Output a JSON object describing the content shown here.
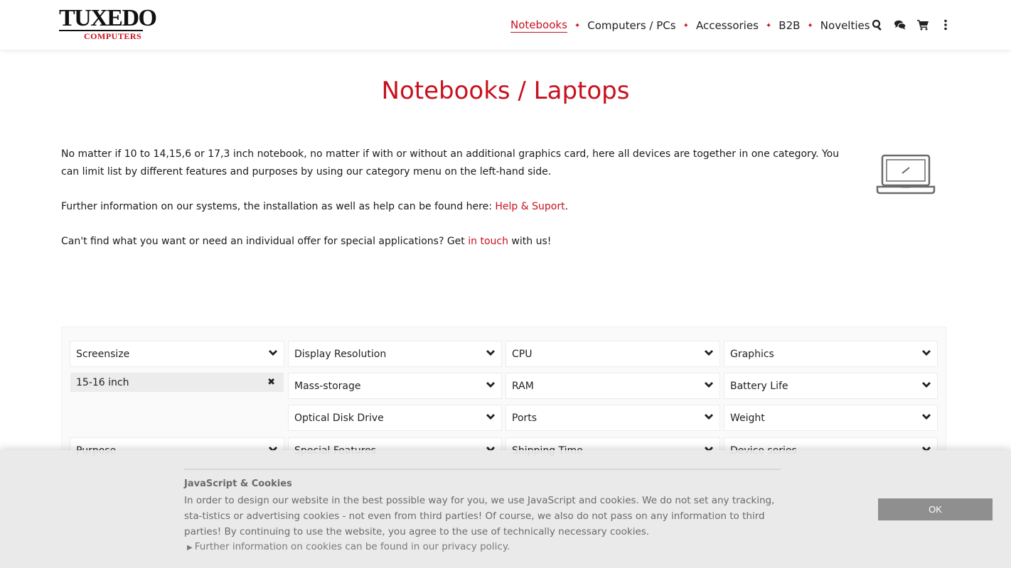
{
  "brand": {
    "name": "TUXEDO",
    "sub": "COMPUTERS"
  },
  "nav": {
    "items": [
      {
        "label": "Notebooks",
        "active": true
      },
      {
        "label": "Computers / PCs"
      },
      {
        "label": "Accessories"
      },
      {
        "label": "B2B"
      },
      {
        "label": "Novelties"
      }
    ],
    "icons": [
      "search-icon",
      "comments-icon",
      "cart-icon",
      "more-vertical-icon"
    ]
  },
  "page": {
    "title": "Notebooks / Laptops",
    "intro1": "No matter if 10 to 14,15,6 or 17,3 inch notebook, no matter if with or without an additional graphics card, here all devices are together in one category. You can limit list by different features and purposes by using our category menu on the left-hand side.",
    "intro2_prefix": "Further information on our systems, the installation as well as help can be found here: ",
    "intro2_link": "Help & Suport",
    "intro2_suffix": ".",
    "intro3_prefix": "Can't find what you want or need an individual offer for special applications? Get ",
    "intro3_link": "in touch",
    "intro3_suffix": " with us!"
  },
  "filters": {
    "screensize": "Screensize",
    "selected": "15-16 inch",
    "display_resolution": "Display Resolution",
    "cpu": "CPU",
    "graphics": "Graphics",
    "mass_storage": "Mass-storage",
    "ram": "RAM",
    "battery_life": "Battery Life",
    "optical": "Optical Disk Drive",
    "ports": "Ports",
    "weight": "Weight",
    "purpose": "Purpose",
    "special_features": "Special Features",
    "shipping_time": "Shipping Time",
    "device_series": "Device series"
  },
  "cookie": {
    "title": "JavaScript & Cookies",
    "text": "In order to design our website in the best possible way for you, we use JavaScript and cookies. We do not set any tracking, sta-tistics or advertising cookies - not even from third parties! Of course, we also do not pass on any information to third parties! By continuing to use the website, you agree to the use of technically necessary cookies.",
    "link": "Further information on cookies can be found in our privacy policy.",
    "ok": "OK"
  },
  "colors": {
    "accent": "#c8101e"
  }
}
